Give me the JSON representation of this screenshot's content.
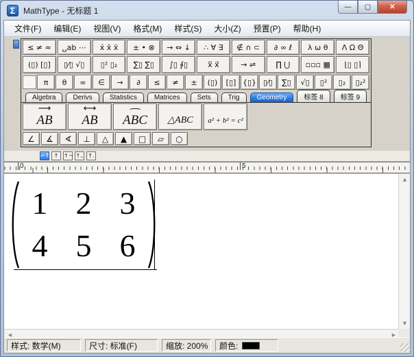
{
  "window": {
    "title": "MathType - 无标题 1",
    "icon_glyph": "Σ",
    "controls": {
      "minimize": "—",
      "maximize": "▢",
      "close": "✕"
    }
  },
  "menu": {
    "items": [
      "文件(F)",
      "编辑(E)",
      "视图(V)",
      "格式(M)",
      "样式(S)",
      "大小(Z)",
      "预置(P)",
      "帮助(H)"
    ]
  },
  "toolbar": {
    "symbol_row1": [
      {
        "name": "relational-symbols-button",
        "glyphs": "≤ ≠ ≈"
      },
      {
        "name": "spaces-ellipses-button",
        "glyphs": "␣ab ⋯"
      },
      {
        "name": "embellishments-button",
        "glyphs": "x́ x̄ ẍ"
      },
      {
        "name": "operator-symbols-button",
        "glyphs": "± • ⊗"
      },
      {
        "name": "arrow-symbols-button",
        "glyphs": "→ ⇔ ↓"
      },
      {
        "name": "logic-symbols-button",
        "glyphs": "∴ ∀ ∃"
      },
      {
        "name": "set-theory-symbols-button",
        "glyphs": "∉ ∩ ⊂"
      },
      {
        "name": "misc-symbols-button",
        "glyphs": "∂ ∞ ℓ"
      },
      {
        "name": "greek-lowercase-button",
        "glyphs": "λ ω θ"
      },
      {
        "name": "greek-uppercase-button",
        "glyphs": "Λ Ω Θ"
      }
    ],
    "template_row2": [
      {
        "name": "fence-templates-button",
        "glyphs": "(▯) [▯]"
      },
      {
        "name": "fraction-radical-templates-button",
        "glyphs": "▯⁄▯ √▯"
      },
      {
        "name": "subscript-superscript-templates-button",
        "glyphs": "▯² ▯₂"
      },
      {
        "name": "summation-templates-button",
        "glyphs": "∑▯ ∑▯"
      },
      {
        "name": "integral-templates-button",
        "glyphs": "∫▯ ∮▯"
      },
      {
        "name": "overbar-underbar-templates-button",
        "glyphs": "x̅ x⃗"
      },
      {
        "name": "labeled-arrow-templates-button",
        "glyphs": "→ ⇌"
      },
      {
        "name": "product-set-templates-button",
        "glyphs": "∏ ⋃"
      },
      {
        "name": "matrix-templates-button",
        "glyphs": "▫▫▫ ▦"
      },
      {
        "name": "box-strike-templates-button",
        "glyphs": "⌊▯ ▯⌉"
      }
    ],
    "small_bar": [
      {
        "name": "pi-button",
        "glyph": "π"
      },
      {
        "name": "theta-button",
        "glyph": "θ"
      },
      {
        "name": "infinity-button",
        "glyph": "∞"
      },
      {
        "name": "element-of-button",
        "glyph": "∈"
      },
      {
        "name": "right-arrow-button",
        "glyph": "→"
      },
      {
        "name": "partial-button",
        "glyph": "∂"
      },
      {
        "name": "leq-button",
        "glyph": "≤"
      },
      {
        "name": "neq-button",
        "glyph": "≠"
      },
      {
        "name": "plus-minus-button",
        "glyph": "±"
      },
      {
        "name": "parens-template-button",
        "glyph": "(▯)"
      },
      {
        "name": "brackets-template-button",
        "glyph": "[▯]"
      },
      {
        "name": "braces-template-button",
        "glyph": "{▯}"
      },
      {
        "name": "fraction-template-button",
        "glyph": "▯⁄▯"
      },
      {
        "name": "sum-template-button",
        "glyph": "∑▯"
      },
      {
        "name": "sqrt-template-button",
        "glyph": "√▯"
      },
      {
        "name": "superscript-template-button",
        "glyph": "▯²"
      },
      {
        "name": "subscript-template-button",
        "glyph": "▯₂"
      },
      {
        "name": "subsuperscript-template-button",
        "glyph": "▯₂²"
      }
    ],
    "tabs": [
      {
        "name": "tab-algebra",
        "label": "Algebra",
        "active": false
      },
      {
        "name": "tab-derivs",
        "label": "Derivs",
        "active": false
      },
      {
        "name": "tab-statistics",
        "label": "Statistics",
        "active": false
      },
      {
        "name": "tab-matrices",
        "label": "Matrices",
        "active": false
      },
      {
        "name": "tab-sets",
        "label": "Sets",
        "active": false
      },
      {
        "name": "tab-trig",
        "label": "Trig",
        "active": false
      },
      {
        "name": "tab-geometry",
        "label": "Geometry",
        "active": true
      },
      {
        "name": "tab-label-8",
        "label": "标签 8",
        "active": false
      },
      {
        "name": "tab-label-9",
        "label": "标签 9",
        "active": false
      }
    ],
    "geometry_large": [
      {
        "name": "vector-ab-template-button",
        "top": "⟶",
        "base": "AB"
      },
      {
        "name": "line-ab-template-button",
        "top": "⟷",
        "base": "AB"
      },
      {
        "name": "arc-abc-template-button",
        "top": "⌢",
        "base": "ABC"
      },
      {
        "name": "triangle-abc-template-button",
        "top": "",
        "base": "△ABC"
      },
      {
        "name": "pythagorean-template-button",
        "top": "",
        "base": "a² + b² = c²"
      }
    ],
    "geometry_small": [
      {
        "name": "angle-button",
        "glyph": "∠"
      },
      {
        "name": "measured-angle-button",
        "glyph": "∡"
      },
      {
        "name": "spherical-angle-button",
        "glyph": "∢"
      },
      {
        "name": "perpendicular-button",
        "glyph": "⊥"
      },
      {
        "name": "triangle-button",
        "glyph": "△"
      },
      {
        "name": "filled-triangle-button",
        "glyph": "▲"
      },
      {
        "name": "square-button",
        "glyph": "□"
      },
      {
        "name": "parallelogram-button",
        "glyph": "▱"
      },
      {
        "name": "circle-button",
        "glyph": "○"
      }
    ]
  },
  "tabstops": [
    {
      "name": "tabstop-left-button",
      "glyph": "⌐↑",
      "active": true
    },
    {
      "name": "tabstop-center-button",
      "glyph": "↑",
      "active": false
    },
    {
      "name": "tabstop-right-button",
      "glyph": "↑¬",
      "active": false
    },
    {
      "name": "tabstop-relational-button",
      "glyph": "↑₌",
      "active": false
    },
    {
      "name": "tabstop-decimal-button",
      "glyph": "↑.",
      "active": false
    }
  ],
  "ruler": {
    "labels": [
      "0",
      "5"
    ]
  },
  "editor": {
    "matrix": {
      "rows": [
        [
          "1",
          "2",
          "3"
        ],
        [
          "4",
          "5",
          "6"
        ]
      ]
    }
  },
  "scrollbar": {
    "up": "▲",
    "down": "▼",
    "left": "◀",
    "right": "▶"
  },
  "statusbar": {
    "style": "样式: 数学(M)",
    "size": "尺寸: 标准(F)",
    "zoom": "缩放: 200%",
    "color_label": "颜色:",
    "color_value": "#000000"
  },
  "colors": {
    "active_tab": "#2e7be4",
    "titlebar": "#bdcfe6"
  }
}
